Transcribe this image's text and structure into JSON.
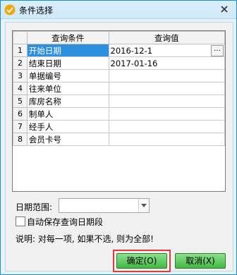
{
  "window": {
    "title": "条件选择"
  },
  "grid": {
    "headers": [
      "",
      "查询条件",
      "查询值"
    ],
    "rows": [
      {
        "num": "1",
        "condition": "开始日期",
        "value": "2016-12-1"
      },
      {
        "num": "2",
        "condition": "结束日期",
        "value": "2017-01-16"
      },
      {
        "num": "3",
        "condition": "单据编号",
        "value": ""
      },
      {
        "num": "4",
        "condition": "往来单位",
        "value": ""
      },
      {
        "num": "5",
        "condition": "库房名称",
        "value": ""
      },
      {
        "num": "6",
        "condition": "制单人",
        "value": ""
      },
      {
        "num": "7",
        "condition": "经手人",
        "value": ""
      },
      {
        "num": "8",
        "condition": "会员卡号",
        "value": ""
      }
    ],
    "ellipsis": "…"
  },
  "date_range": {
    "label": "日期范围:",
    "value": ""
  },
  "auto_save": {
    "label": "自动保存查询日期段",
    "checked": false
  },
  "note": "说明: 对每一项, 如果不选, 则为全部!",
  "buttons": {
    "ok": "确定(O)",
    "cancel": "取消(X)"
  },
  "colors": {
    "selected_row": "#2d8fdf",
    "button_green": "#43b843",
    "highlight_box": "#e23a3a",
    "title_border": "#1a8fd6"
  }
}
